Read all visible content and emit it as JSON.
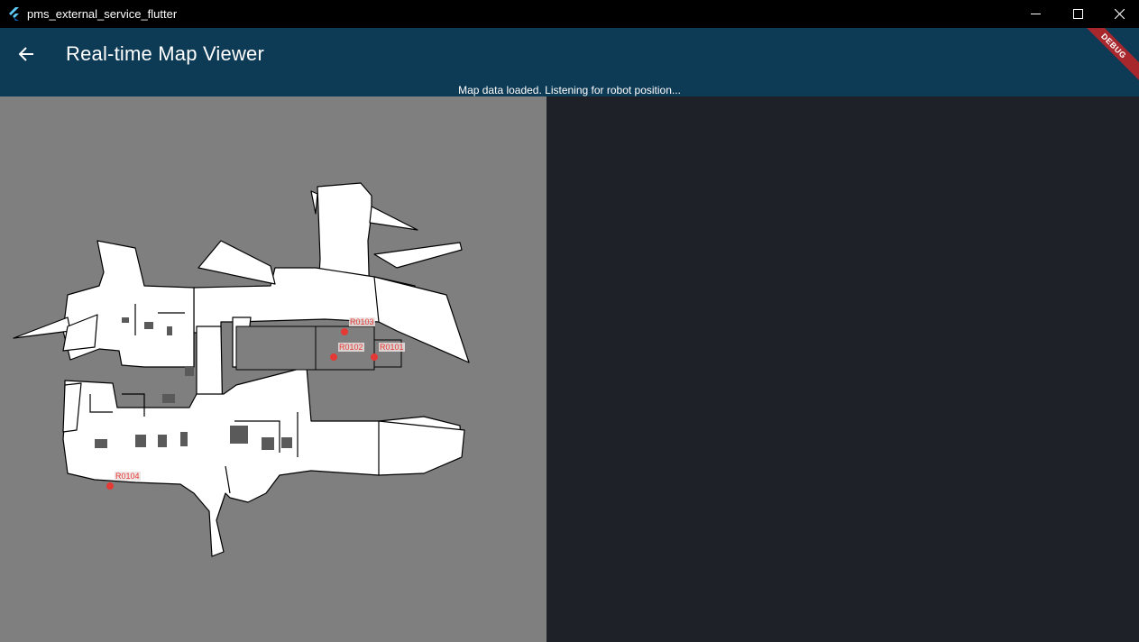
{
  "window": {
    "title": "pms_external_service_flutter",
    "icon": "flutter-logo-icon",
    "controls": [
      "minimize-icon",
      "maximize-icon",
      "close-icon"
    ]
  },
  "appbar": {
    "back_icon": "arrow-back-icon",
    "title": "Real-time Map Viewer",
    "status": "Map data loaded. Listening for robot position...",
    "debug_banner": "DEBUG",
    "background_color": "#0d3a54"
  },
  "map": {
    "background_color": "#7f7f7f",
    "free_space_color": "#ffffff",
    "robots": [
      {
        "id": "R0103",
        "label": "R0103"
      },
      {
        "id": "R0102",
        "label": "R0102"
      },
      {
        "id": "R0101",
        "label": "R0101"
      },
      {
        "id": "R0104",
        "label": "R0104"
      }
    ],
    "marker_color": "#e53935"
  },
  "right_panel": {
    "background_color": "#1e2228"
  }
}
